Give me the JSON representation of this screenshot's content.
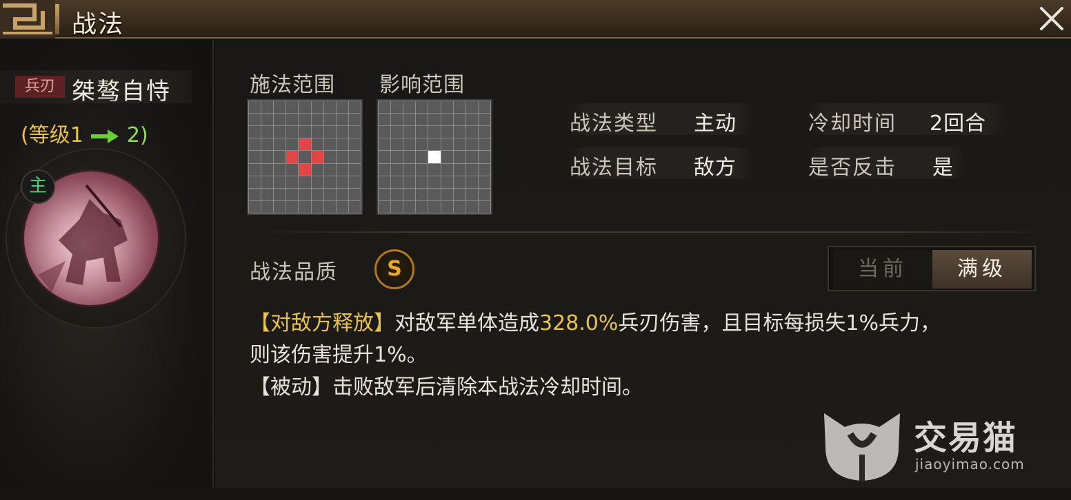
{
  "window": {
    "title": "战法",
    "close_label": "×"
  },
  "skill": {
    "weapon_tag": "兵刃",
    "name": "桀骜自恃",
    "level_prefix": "(等级1",
    "level_next": "2)",
    "portrait_badge": "主"
  },
  "range": {
    "cast_label": "施法范围",
    "effect_label": "影响范围",
    "cast_grid_red_cells": [
      [
        3,
        4
      ],
      [
        4,
        3
      ],
      [
        4,
        5
      ],
      [
        5,
        4
      ]
    ],
    "effect_grid_white_cells": [
      [
        4,
        4
      ]
    ]
  },
  "info": {
    "type_label": "战法类型",
    "type_value": "主动",
    "cooldown_label": "冷却时间",
    "cooldown_value": "2回合",
    "target_label": "战法目标",
    "target_value": "敌方",
    "counter_label": "是否反击",
    "counter_value": "是"
  },
  "quality": {
    "label": "战法品质",
    "grade": "S",
    "grade_color": "#e8a830"
  },
  "toggle": {
    "current_label": "当前",
    "max_label": "满级",
    "selected": "满级"
  },
  "description": {
    "line1_tag": "【对敌方释放】",
    "line1_a": "对敌军单体造成",
    "line1_value": "328.0%",
    "line1_b": "兵刃伤害，且目标每损失1%兵力，",
    "line2": "则该伤害提升1%。",
    "line3": "【被动】击败敌军后清除本战法冷却时间。"
  },
  "watermark": {
    "cn": "交易猫",
    "en": "jiaoyimao.com"
  },
  "colors": {
    "accent_gold": "#e8c24a",
    "level_green": "#8fe04e",
    "range_red": "#e04646"
  }
}
